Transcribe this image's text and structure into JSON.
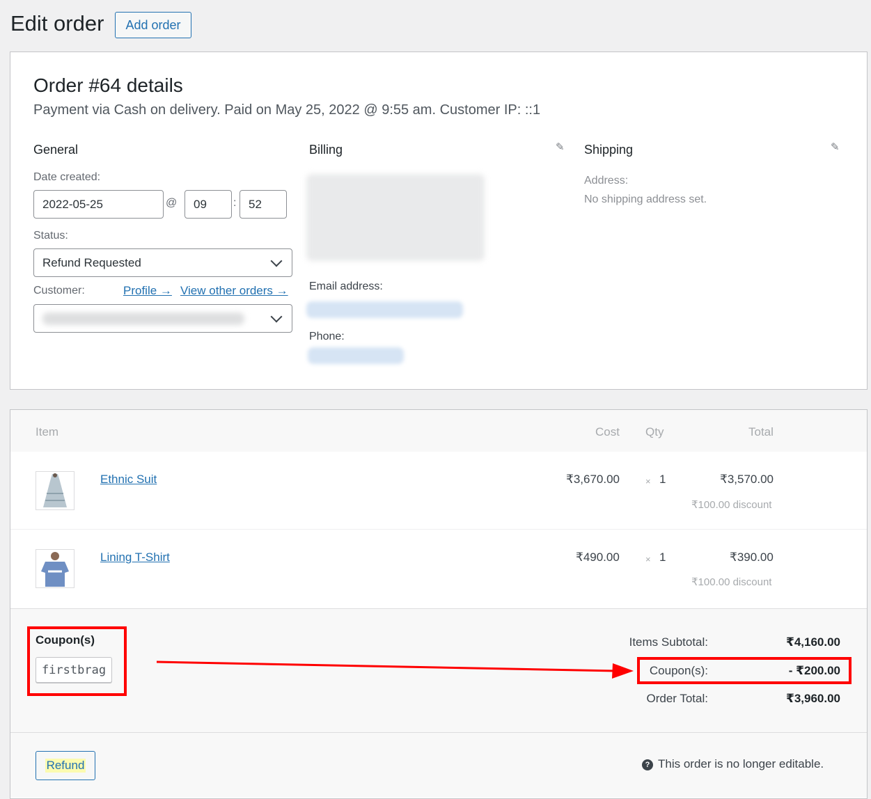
{
  "header": {
    "title": "Edit order",
    "add_order_label": "Add order"
  },
  "order": {
    "title": "Order #64 details",
    "subtitle": "Payment via Cash on delivery. Paid on May 25, 2022 @ 9:55 am. Customer IP: ::1"
  },
  "general": {
    "heading": "General",
    "date_label": "Date created:",
    "date_value": "2022-05-25",
    "at_sign": "@",
    "hour_value": "09",
    "time_sep": ":",
    "minute_value": "52",
    "status_label": "Status:",
    "status_value": "Refund Requested",
    "customer_label": "Customer:",
    "profile_link": "Profile →",
    "other_orders_link": "View other orders →",
    "customer_value": ""
  },
  "billing": {
    "heading": "Billing",
    "edit_icon": "pencil-icon",
    "email_label": "Email address:",
    "phone_label": "Phone:"
  },
  "shipping": {
    "heading": "Shipping",
    "edit_icon": "pencil-icon",
    "address_label": "Address:",
    "address_value": "No shipping address set."
  },
  "items_table": {
    "columns": {
      "item": "Item",
      "cost": "Cost",
      "qty": "Qty",
      "total": "Total"
    },
    "rows": [
      {
        "name": "Ethnic Suit",
        "cost": "₹3,670.00",
        "qty_prefix": "×",
        "qty": "1",
        "total": "₹3,570.00",
        "discount": "₹100.00 discount"
      },
      {
        "name": "Lining T-Shirt",
        "cost": "₹490.00",
        "qty_prefix": "×",
        "qty": "1",
        "total": "₹390.00",
        "discount": "₹100.00 discount"
      }
    ]
  },
  "coupons": {
    "title": "Coupon(s)",
    "codes": [
      "firstbrag"
    ]
  },
  "totals": {
    "subtotal_label": "Items Subtotal:",
    "subtotal_value": "₹4,160.00",
    "coupon_label": "Coupon(s):",
    "coupon_value": "- ₹200.00",
    "order_total_label": "Order Total:",
    "order_total_value": "₹3,960.00"
  },
  "footer": {
    "refund_label": "Refund",
    "help_icon": "?",
    "note": "This order is no longer editable."
  },
  "annotation": {
    "color": "#ff0000"
  }
}
